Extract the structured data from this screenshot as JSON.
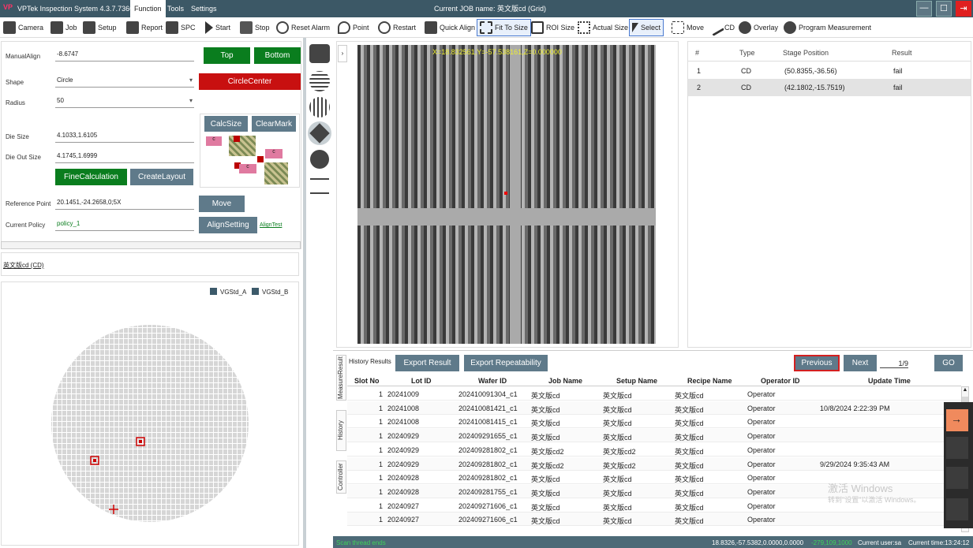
{
  "titlebar": {
    "logo": "VP",
    "app_title": "VPTek Inspection System 4.3.7.7366",
    "menu": [
      "Function",
      "Tools",
      "Settings"
    ],
    "job_name": "Current JOB name: 英文版cd (Grid)"
  },
  "toolbar": {
    "items": [
      "Camera",
      "Job",
      "Setup",
      "Report",
      "SPC",
      "Start",
      "Stop",
      "Reset Alarm",
      "Point",
      "Restart",
      "Quick Align",
      "Fit To Size",
      "ROI Size",
      "Actual Size",
      "Select",
      "Move",
      "CD",
      "Overlay",
      "Program Measurement"
    ]
  },
  "align": {
    "manual_align_label": "ManualAlign",
    "manual_align_value": "-8.6747",
    "top_btn": "Top",
    "bottom_btn": "Bottom",
    "shape_label": "Shape",
    "shape_value": "Circle",
    "circle_center_btn": "CircleCenter",
    "radius_label": "Radius",
    "radius_value": "50",
    "calc_size_btn": "CalcSize",
    "clear_mark_btn": "ClearMark",
    "die_size_label": "Die Size",
    "die_size_value": "4.1033,1.6105",
    "die_out_size_label": "Die Out Size",
    "die_out_size_value": "4.1745,1.6999",
    "fine_calc_btn": "FineCalculation",
    "create_layout_btn": "CreateLayout",
    "ref_point_label": "Reference Point",
    "ref_point_value": "20.1451,-24.2658,0;5X",
    "move_btn": "Move",
    "policy_label": "Current Policy",
    "policy_value": "policy_1",
    "align_setting_btn": "AlignSetting",
    "align_test_link": "AlignTest",
    "diagram_marks": [
      "c",
      "c",
      "c"
    ]
  },
  "recipe_link": "英文版cd (CD)",
  "wafer": {
    "checks": [
      "VGStd_A",
      "VGStd_B"
    ]
  },
  "image": {
    "overlay_text": "X=18.832561,Y=-57.538161,Z=0.000000"
  },
  "points_table": {
    "headers": [
      "#",
      "Type",
      "Stage Position",
      "Result"
    ],
    "rows": [
      {
        "n": "1",
        "type": "CD",
        "pos": "(50.8355,-36.56)",
        "result": "fail"
      },
      {
        "n": "2",
        "type": "CD",
        "pos": "(42.1802,-15.7519)",
        "result": "fail"
      }
    ]
  },
  "history": {
    "label": "History Results",
    "export_result_btn": "Export Result",
    "export_repeat_btn": "Export Repeatability",
    "previous_btn": "Previous",
    "next_btn": "Next",
    "page": "1/9",
    "go_btn": "GO",
    "vtabs": [
      "MeasureResult",
      "History",
      "Controller"
    ],
    "headers": [
      "Slot No",
      "Lot ID",
      "Wafer ID",
      "Job Name",
      "Setup Name",
      "Recipe Name",
      "Operator ID",
      "Update Time"
    ],
    "rows": [
      [
        "1",
        "20241009",
        "202410091304_c1",
        "英文版cd",
        "英文版cd",
        "英文版cd",
        "Operator",
        ""
      ],
      [
        "1",
        "20241008",
        "202410081421_c1",
        "英文版cd",
        "英文版cd",
        "英文版cd",
        "Operator",
        "10/8/2024 2:22:39 PM"
      ],
      [
        "1",
        "20241008",
        "202410081415_c1",
        "英文版cd",
        "英文版cd",
        "英文版cd",
        "Operator",
        ""
      ],
      [
        "1",
        "20240929",
        "202409291655_c1",
        "英文版cd",
        "英文版cd",
        "英文版cd",
        "Operator",
        ""
      ],
      [
        "1",
        "20240929",
        "202409281802_c1",
        "英文版cd2",
        "英文版cd2",
        "英文版cd",
        "Operator",
        ""
      ],
      [
        "1",
        "20240929",
        "202409281802_c1",
        "英文版cd2",
        "英文版cd2",
        "英文版cd",
        "Operator",
        "9/29/2024 9:35:43 AM"
      ],
      [
        "1",
        "20240928",
        "202409281802_c1",
        "英文版cd",
        "英文版cd",
        "英文版cd",
        "Operator",
        ""
      ],
      [
        "1",
        "20240928",
        "202409281755_c1",
        "英文版cd",
        "英文版cd",
        "英文版cd",
        "Operator",
        ""
      ],
      [
        "1",
        "20240927",
        "202409271606_c1",
        "英文版cd",
        "英文版cd",
        "英文版cd",
        "Operator",
        ""
      ],
      [
        "1",
        "20240927",
        "202409271606_c1",
        "英文版cd",
        "英文版cd",
        "英文版cd",
        "Operator",
        ""
      ]
    ]
  },
  "watermark": {
    "line1": "激活 Windows",
    "line2": "转到\"设置\"以激活 Windows。"
  },
  "statusbar": {
    "left": "Scan thread ends",
    "coords": "18.8326,-57.5382,0.0000,0.0000",
    "coords2": "-279,109,1000",
    "user": "Current user:sa",
    "time": "Current time:13:24:12"
  }
}
